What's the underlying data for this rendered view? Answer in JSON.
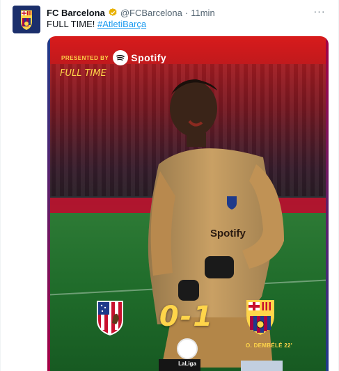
{
  "author": {
    "name": "FC Barcelona",
    "handle": "@FCBarcelona",
    "separator": "·",
    "time": "11min",
    "avatar_icon": "fcb-crest-icon",
    "verified_icon": "verified-badge-icon"
  },
  "more_label": "···",
  "tweet": {
    "text": "FULL TIME!",
    "hashtag": "#AtletiBarça"
  },
  "graphic": {
    "presented_by": "PRESENTED BY",
    "sponsor": "Spotify",
    "status": "FULL TIME",
    "score": "0-1",
    "scorer": "O. DEMBÉLÉ  22'",
    "league": "LaLiga",
    "home_crest": "atletico-madrid-crest-icon",
    "away_crest": "fc-barcelona-crest-icon",
    "sponsor_on_shirt": "Spotify"
  },
  "colors": {
    "accent_gold": "#ffd54a",
    "link_blue": "#1d9bf0",
    "barca_blue": "#1e3a8a",
    "barca_red": "#a50044",
    "atleti_red": "#c8102e"
  }
}
